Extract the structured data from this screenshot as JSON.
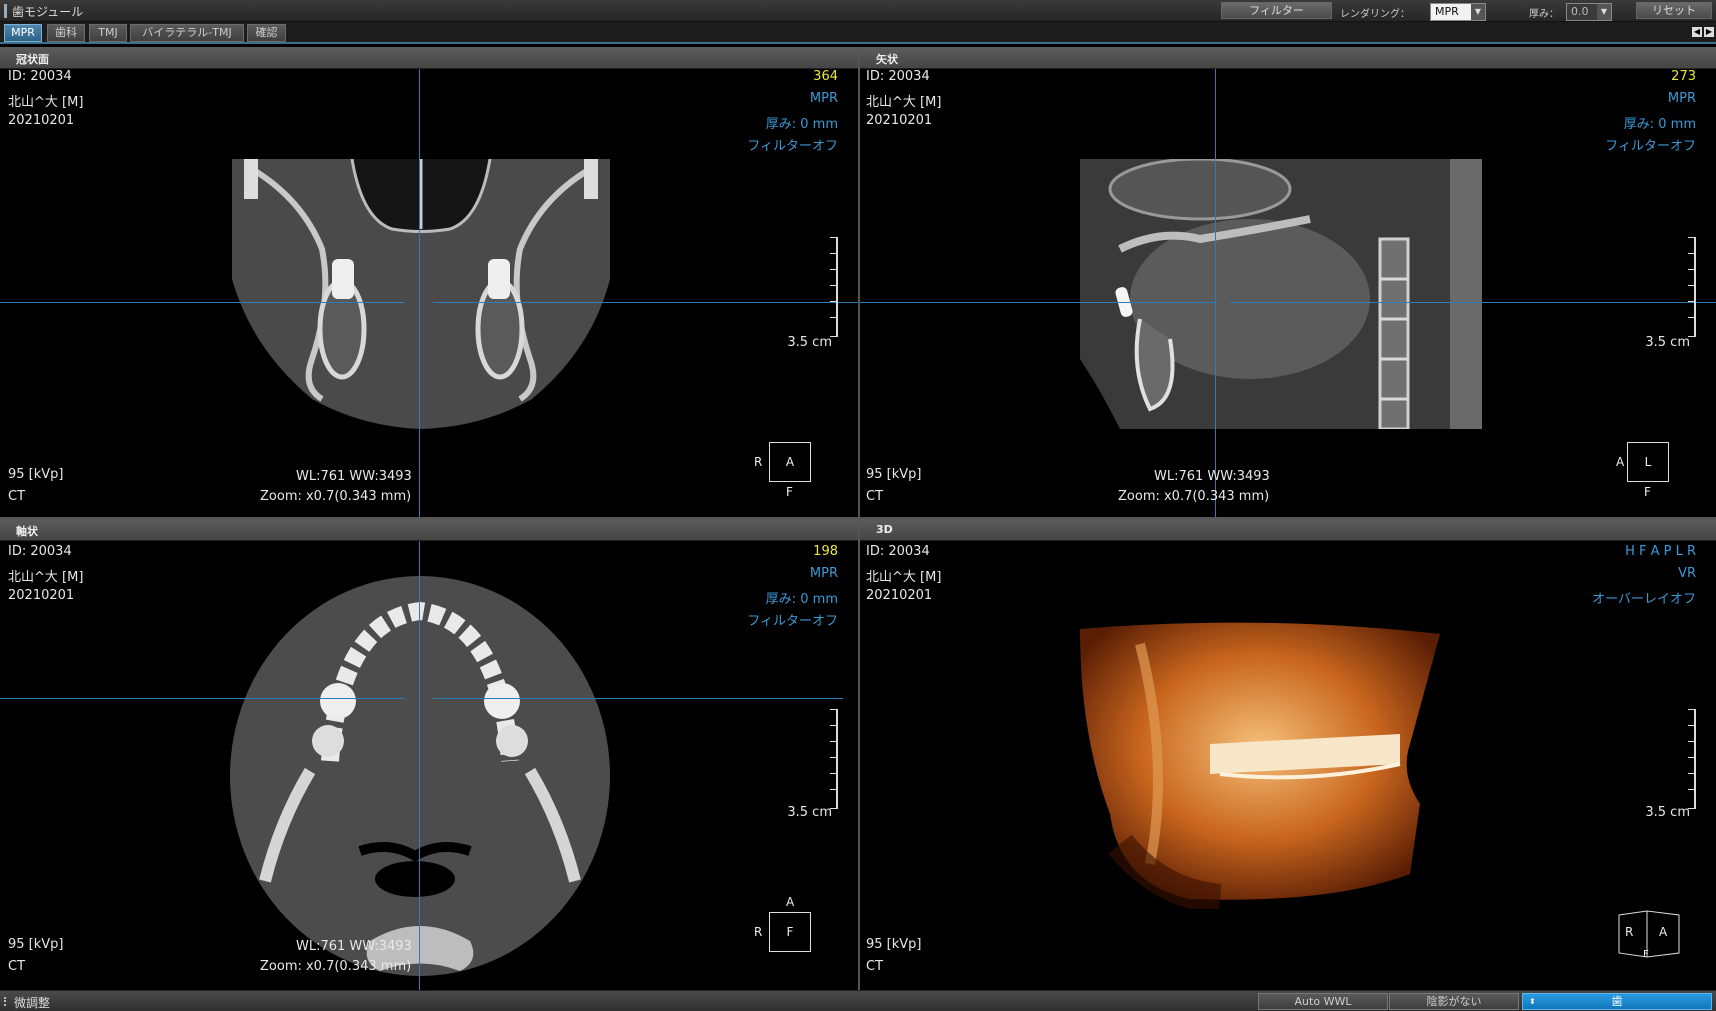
{
  "app": {
    "title": "歯モジュール",
    "filter_button": "フィルター",
    "rendering_label": "レンダリング：",
    "rendering_value": "MPR",
    "thickness_label": "厚み：",
    "thickness_value": "0.0",
    "reset_button": "リセット"
  },
  "tabs": [
    {
      "label": "MPR"
    },
    {
      "label": "歯科"
    },
    {
      "label": "TMJ"
    },
    {
      "label": "バイラテラル-TMJ"
    },
    {
      "label": "確認"
    }
  ],
  "panels": {
    "coronal": {
      "header": "冠状面",
      "id": "ID: 20034",
      "patient": "北山^大 [M]",
      "date": "20210201",
      "slice": "364",
      "mode": "MPR",
      "thickness": "厚み: 0 mm",
      "filter": "フィルターオフ",
      "scale_label": "3.5 cm",
      "kvp": "95 [kVp]",
      "modality": "CT",
      "wlww": "WL:761 WW:3493",
      "zoom": "Zoom: x0.7(0.343 mm)",
      "orient_left": "R",
      "orient_center": "A",
      "orient_bottom": "F"
    },
    "sagittal": {
      "header": "矢状",
      "id": "ID: 20034",
      "patient": "北山^大 [M]",
      "date": "20210201",
      "slice": "273",
      "mode": "MPR",
      "thickness": "厚み: 0 mm",
      "filter": "フィルターオフ",
      "scale_label": "3.5 cm",
      "kvp": "95 [kVp]",
      "modality": "CT",
      "wlww": "WL:761 WW:3493",
      "zoom": "Zoom: x0.7(0.343 mm)",
      "orient_left": "A",
      "orient_center": "L",
      "orient_bottom": "F"
    },
    "axial": {
      "header": "軸状",
      "id": "ID: 20034",
      "patient": "北山^大 [M]",
      "date": "20210201",
      "slice": "198",
      "mode": "MPR",
      "thickness": "厚み: 0 mm",
      "filter": "フィルターオフ",
      "scale_label": "3.5 cm",
      "kvp": "95 [kVp]",
      "modality": "CT",
      "wlww": "WL:761 WW:3493",
      "zoom": "Zoom: x0.7(0.343 mm)",
      "orient_left": "R",
      "orient_center": "F",
      "orient_top": "A"
    },
    "volume": {
      "header": "3D",
      "id": "ID: 20034",
      "patient": "北山^大 [M]",
      "date": "20210201",
      "view_dirs": "H F A P L R",
      "mode": "VR",
      "overlay": "オーバーレイオフ",
      "scale_label": "3.5 cm",
      "kvp": "95 [kVp]",
      "modality": "CT",
      "cube_left": "R",
      "cube_right": "A",
      "cube_bottom": "F"
    }
  },
  "statusbar": {
    "label": "微調整",
    "auto_wwl": "Auto WWL",
    "shading": "陰影がない",
    "tooth": "歯"
  }
}
